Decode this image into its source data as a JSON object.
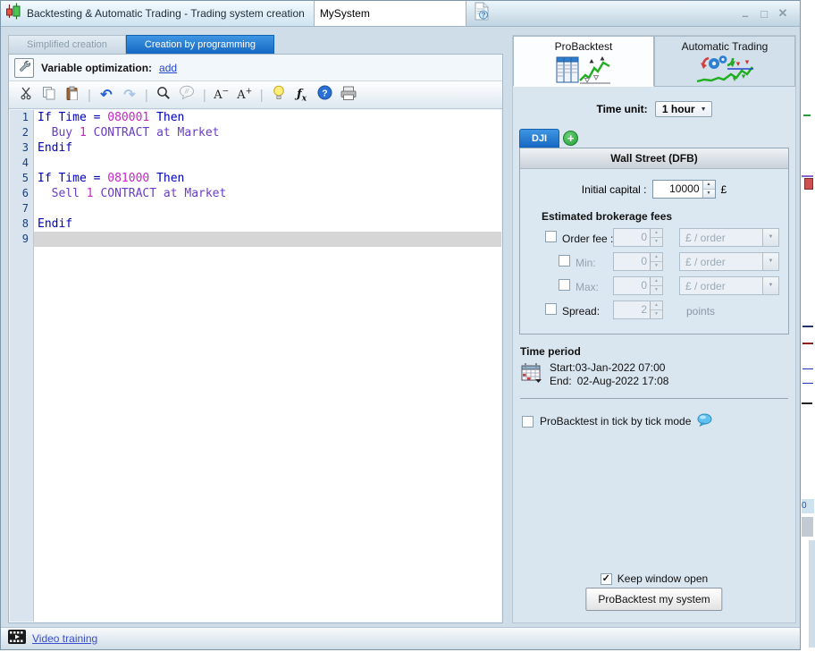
{
  "window": {
    "title": "Backtesting & Automatic Trading - Trading system creation",
    "system_name_value": "MySystem"
  },
  "left_panel": {
    "tabs": [
      {
        "label": "Simplified creation",
        "active": false
      },
      {
        "label": "Creation by programming",
        "active": true
      }
    ],
    "variable_optimization_label": "Variable optimization:",
    "add_link": "add",
    "toolbar": [
      "cut",
      "copy",
      "paste",
      "sep",
      "undo",
      "redo",
      "sep",
      "search",
      "comment",
      "sep",
      "font-decrease",
      "font-increase",
      "sep",
      "bulb",
      "fx",
      "help",
      "print"
    ],
    "editor_lines": [
      {
        "num": "1",
        "segments": [
          {
            "t": "If Time = ",
            "c": "k"
          },
          {
            "t": "080001",
            "c": "n"
          },
          {
            "t": " Then",
            "c": "k"
          }
        ]
      },
      {
        "num": "2",
        "segments": [
          {
            "t": "  ",
            "c": "p"
          },
          {
            "t": "Buy",
            "c": "o"
          },
          {
            "t": " ",
            "c": "p"
          },
          {
            "t": "1",
            "c": "n"
          },
          {
            "t": " CONTRACT at Market",
            "c": "o"
          }
        ]
      },
      {
        "num": "3",
        "segments": [
          {
            "t": "Endif",
            "c": "k"
          }
        ]
      },
      {
        "num": "4",
        "segments": []
      },
      {
        "num": "5",
        "segments": [
          {
            "t": "If Time = ",
            "c": "k"
          },
          {
            "t": "081000",
            "c": "n"
          },
          {
            "t": " Then",
            "c": "k"
          }
        ]
      },
      {
        "num": "6",
        "segments": [
          {
            "t": "  ",
            "c": "p"
          },
          {
            "t": "Sell",
            "c": "o"
          },
          {
            "t": " ",
            "c": "p"
          },
          {
            "t": "1",
            "c": "n"
          },
          {
            "t": " CONTRACT at Market",
            "c": "o"
          }
        ]
      },
      {
        "num": "7",
        "segments": []
      },
      {
        "num": "8",
        "segments": [
          {
            "t": "Endif",
            "c": "k"
          }
        ]
      },
      {
        "num": "9",
        "segments": [],
        "current": true
      }
    ]
  },
  "right_panel": {
    "mode_tabs": [
      {
        "label": "ProBacktest",
        "active": true
      },
      {
        "label": "Automatic Trading",
        "active": false
      }
    ],
    "time_unit_label": "Time unit:",
    "time_unit_value": "1 hour",
    "market_tab_label": "DJI",
    "add_market_label": "+",
    "instrument_header": "Wall Street (DFB)",
    "initial_capital_label": "Initial capital :",
    "initial_capital_value": "10000",
    "currency_symbol": "£",
    "fees_heading": "Estimated brokerage fees",
    "fee_rows": [
      {
        "label": "Order fee :",
        "checked": false,
        "value": "0",
        "unit": "£ / order",
        "unit_type": "dropdown",
        "disabled_label": false,
        "indent": false
      },
      {
        "label": "Min:",
        "checked": false,
        "value": "0",
        "unit": "£ / order",
        "unit_type": "dropdown",
        "disabled_label": true,
        "indent": true
      },
      {
        "label": "Max:",
        "checked": false,
        "value": "0",
        "unit": "£ / order",
        "unit_type": "dropdown",
        "disabled_label": true,
        "indent": true
      },
      {
        "label": "Spread:",
        "checked": false,
        "value": "2",
        "unit": "points",
        "unit_type": "text",
        "disabled_label": false,
        "indent": false
      }
    ],
    "time_period_heading": "Time period",
    "period_start_label": "Start:",
    "period_start_value": "03-Jan-2022 07:00",
    "period_end_label": "End:",
    "period_end_value": "02-Aug-2022 17:08",
    "tick_mode_label": "ProBacktest in tick by tick mode",
    "tick_mode_checked": false,
    "keep_window_label": "Keep window open",
    "keep_window_checked": true,
    "run_button_label": "ProBacktest my system"
  },
  "status_bar": {
    "video_training_label": "Video training"
  },
  "background_sliver": {
    "zero_label": "0"
  }
}
